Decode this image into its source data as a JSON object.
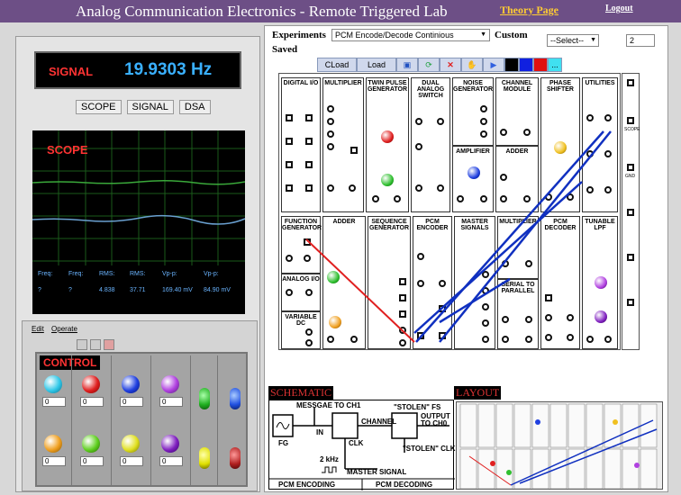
{
  "header": {
    "title": "Analog Communication Electronics - Remote Triggered Lab",
    "theory_link": "Theory Page",
    "logout_link": "Logout"
  },
  "signal": {
    "label": "SIGNAL",
    "value": "19.9303 Hz"
  },
  "tabs": [
    "SCOPE",
    "SIGNAL",
    "DSA"
  ],
  "scope": {
    "label": "SCOPE",
    "readout_headers": [
      "Freq:",
      "Freq:",
      "RMS:",
      "RMS:",
      "Vp-p:",
      "Vp-p:"
    ],
    "readout_values": [
      "?",
      "?",
      "4.838",
      "37.71",
      "169.40 mV",
      "84.90 mV"
    ]
  },
  "control_panel": {
    "menu": [
      "Edit",
      "Operate"
    ],
    "title": "CONTROL",
    "knob_values": [
      "0",
      "0",
      "0",
      "0",
      "0",
      "0",
      "0",
      "0"
    ],
    "knob_colors": [
      "#30c8e8",
      "#e02020",
      "#2040e0",
      "#b040e0",
      "#f0a020",
      "#60d020",
      "#e0e020",
      "#8020c0"
    ],
    "led_colors": [
      "#20b020",
      "#2050e0",
      "#e0e000",
      "#b02020"
    ]
  },
  "experiments": {
    "label": "Experiments",
    "selected": "PCM Encode/Decode Continious",
    "saved_label": "Saved",
    "custom_label": "Custom",
    "custom_select": "--Select--",
    "number": "2"
  },
  "toolbar": {
    "cload": "CLoad",
    "load": "Load"
  },
  "modules": {
    "digital_io": "DIGITAL I/O",
    "multiplier": "MULTIPLIER",
    "twin_pulse": "TWIN PULSE GENERATOR",
    "dual_analog": "DUAL ANALOG SWITCH",
    "noise_gen": "NOISE GENERATOR",
    "channel_module": "CHANNEL MODULE",
    "phase_shifter": "PHASE SHIFTER",
    "utilities": "UTILITIES",
    "function_gen": "FUNCTION GENERATOR",
    "adder": "ADDER",
    "sequence_gen": "SEQUENCE GENERATOR",
    "pcm_encoder": "PCM ENCODER",
    "master_signals": "MASTER SIGNALS",
    "pcm_decoder": "PCM DECODER",
    "tunable_lpf": "TUNABLE LPF",
    "amplifier": "AMPLIFIER",
    "serial_parallel": "SERIAL TO PARALLEL",
    "analog_io": "ANALOG I/O",
    "variable_dc": "VARIABLE DC",
    "scope_label": "SCOPE",
    "gnd": "GND"
  },
  "schematic": {
    "title": "SCHEMATIC",
    "message": "MESSGAE TO CH1",
    "channel": "CHANNEL",
    "stolen_fs": "\"STOLEN\" FS",
    "output": "OUTPUT TO CH0",
    "fg": "FG",
    "in": "IN",
    "clk": "CLK",
    "stolen_clk": "\"STOLEN\" CLK",
    "freq": "2 kHz",
    "master": "MASTER SIGNAL",
    "pcm_encoding": "PCM ENCODING",
    "pcm_decoding": "PCM DECODING"
  },
  "layout": {
    "title": "LAYOUT"
  }
}
